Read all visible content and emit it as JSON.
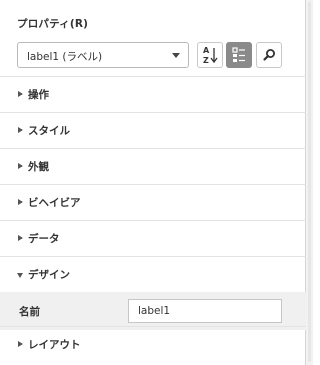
{
  "panel": {
    "title": "プロパティ(R)",
    "selector": {
      "value": "label1 (ラベル)"
    },
    "toolbar": {
      "sort_az_icon": "sort-az-icon",
      "categorized_icon": "categorized-icon",
      "search_icon": "search-icon",
      "active_button": "categorized"
    },
    "sections": [
      {
        "label": "操作",
        "expanded": false
      },
      {
        "label": "スタイル",
        "expanded": false
      },
      {
        "label": "外観",
        "expanded": false
      },
      {
        "label": "ビヘイビア",
        "expanded": false
      },
      {
        "label": "データ",
        "expanded": false
      },
      {
        "label": "デザイン",
        "expanded": true
      },
      {
        "label": "レイアウト",
        "expanded": false
      }
    ],
    "design_properties": [
      {
        "name": "名前",
        "value": "label1"
      }
    ]
  },
  "colors": {
    "active_button_bg": "#8a8a8a",
    "property_row_bg": "#f0f0f0",
    "border": "#d6d6d6"
  }
}
